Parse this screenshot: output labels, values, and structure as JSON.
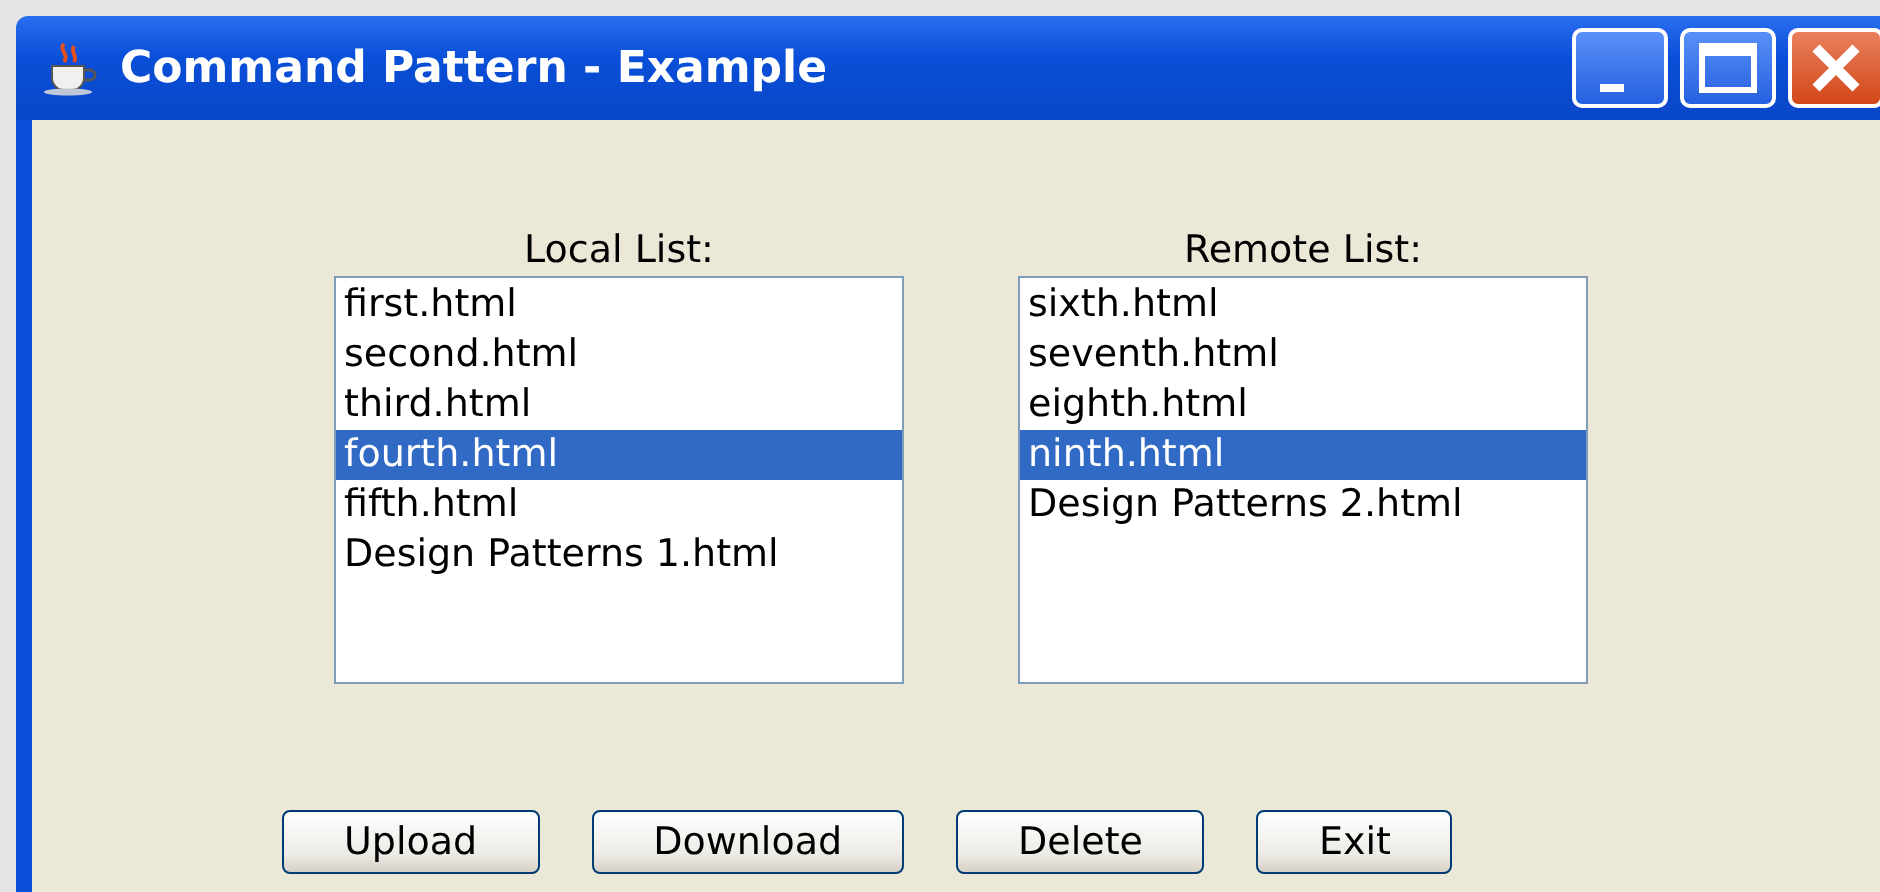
{
  "window": {
    "title": "Command Pattern - Example"
  },
  "lists": [
    {
      "label": "Local List:",
      "items": [
        {
          "text": "first.html",
          "selected": false
        },
        {
          "text": "second.html",
          "selected": false
        },
        {
          "text": "third.html",
          "selected": false
        },
        {
          "text": "fourth.html",
          "selected": true
        },
        {
          "text": "fifth.html",
          "selected": false
        },
        {
          "text": "Design Patterns 1.html",
          "selected": false
        }
      ]
    },
    {
      "label": "Remote List:",
      "items": [
        {
          "text": "sixth.html",
          "selected": false
        },
        {
          "text": "seventh.html",
          "selected": false
        },
        {
          "text": "eighth.html",
          "selected": false
        },
        {
          "text": "ninth.html",
          "selected": true
        },
        {
          "text": "Design Patterns 2.html",
          "selected": false
        }
      ]
    }
  ],
  "buttons": [
    {
      "label": "Upload"
    },
    {
      "label": "Download"
    },
    {
      "label": "Delete"
    },
    {
      "label": "Exit"
    }
  ]
}
